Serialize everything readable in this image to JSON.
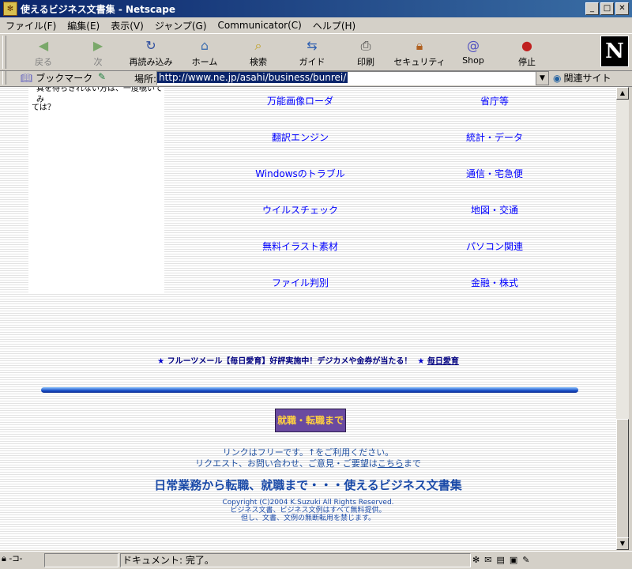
{
  "window": {
    "title": "使えるビジネス文書集 - Netscape"
  },
  "menu": [
    "ファイル(F)",
    "編集(E)",
    "表示(V)",
    "ジャンプ(G)",
    "Communicator(C)",
    "ヘルプ(H)"
  ],
  "toolbar": {
    "back": "戻る",
    "forward": "次",
    "reload": "再読み込み",
    "home": "ホーム",
    "search": "検索",
    "guide": "ガイド",
    "print": "印刷",
    "security": "セキュリティ",
    "shop": "Shop",
    "stop": "停止"
  },
  "location": {
    "bookmarks": "ブックマーク",
    "label": "場所:",
    "url": "http://www.ne.jp/asahi/business/bunrei/",
    "related": "関連サイト"
  },
  "content": {
    "left_text_1": "真を待ちきれない方は、一度覗いてみ",
    "left_text_2": "ては？",
    "links_left": [
      "万能画像ローダ",
      "翻訳エンジン",
      "Windowsのトラブル",
      "ウイルスチェック",
      "無料イラスト素材",
      "ファイル判別"
    ],
    "links_right": [
      "省庁等",
      "統計・データ",
      "通信・宅急便",
      "地図・交通",
      "パソコン関連",
      "金融・株式"
    ],
    "promo_text": "フルーツメール【毎日愛育】好評実施中！デジカメや金券が当たる！",
    "promo_link": "毎日愛育",
    "jump_button": "就職・転職まで",
    "footer_line1": "リンクはフリーです。↑をご利用ください。",
    "footer_line2_pre": "リクエスト、お問い合わせ、ご意見・ご要望は",
    "footer_line2_link": "こちら",
    "footer_line2_post": "まで",
    "footer_title": "日常業務から転職、就職まで・・・使えるビジネス文書集",
    "copyright": "Copyright (C)2004 K.Suzuki All Rights Reserved.",
    "copy_line2": "ビジネス文書、ビジネス文例はすべて無料提供。",
    "copy_line3": "但し、文書、文例の無断転用を禁じます。"
  },
  "status": {
    "text": "ドキュメント: 完了。"
  }
}
